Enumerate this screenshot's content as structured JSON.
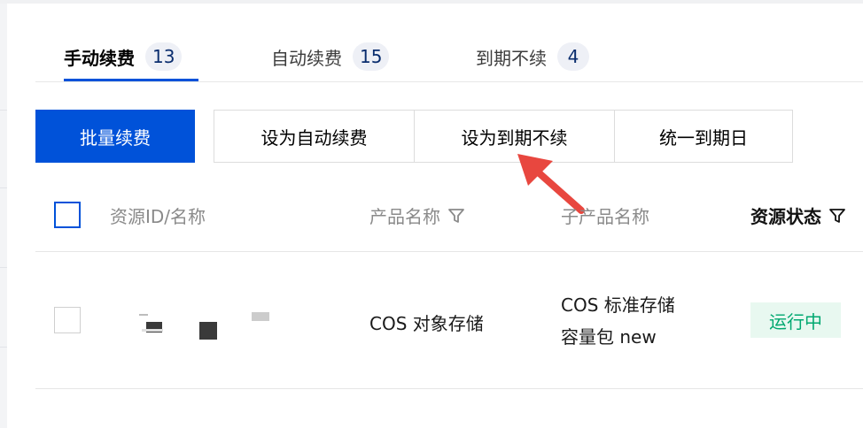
{
  "tabs": [
    {
      "label": "手动续费",
      "count": "13",
      "active": true
    },
    {
      "label": "自动续费",
      "count": "15",
      "active": false
    },
    {
      "label": "到期不续",
      "count": "4",
      "active": false
    }
  ],
  "toolbar": {
    "batch_renew": "批量续费",
    "set_auto_renew": "设为自动续费",
    "set_no_renew": "设为到期不续",
    "unify_expiry": "统一到期日"
  },
  "table": {
    "headers": {
      "resource_id": "资源ID/名称",
      "product_name": "产品名称",
      "sub_product_name": "子产品名称",
      "resource_status": "资源状态"
    },
    "rows": [
      {
        "product_name": "COS 对象存储",
        "sub_product_line1": "COS 标准存储",
        "sub_product_line2": "容量包 new",
        "status": "运行中"
      }
    ]
  },
  "colors": {
    "primary": "#0052d9",
    "status_green": "#00a870",
    "arrow_red": "#e8473f"
  }
}
